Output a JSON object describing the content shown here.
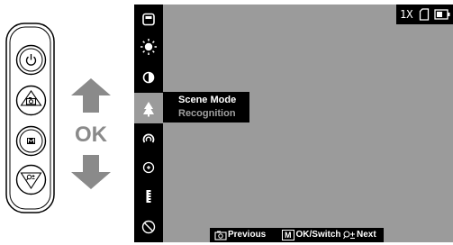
{
  "remote": {
    "buttons": [
      {
        "icon": "power-icon"
      },
      {
        "icon": "camera-icon"
      },
      {
        "icon": "menu-m-icon"
      },
      {
        "icon": "zoom-down-icon"
      }
    ]
  },
  "navigation": {
    "up_icon": "arrow-up-icon",
    "ok_label": "OK",
    "down_icon": "arrow-down-icon"
  },
  "screen": {
    "zoom_level": "1X",
    "menu": {
      "items": [
        {
          "icon": "display-icon"
        },
        {
          "icon": "brightness-icon"
        },
        {
          "icon": "contrast-icon"
        },
        {
          "icon": "scene-mode-icon",
          "selected": true
        },
        {
          "icon": "palette-icon"
        },
        {
          "icon": "reticle-icon"
        },
        {
          "icon": "calibration-icon"
        },
        {
          "icon": "disable-icon"
        }
      ]
    },
    "popup": {
      "title": "Scene Mode",
      "value": "Recognition"
    },
    "hints": {
      "previous": "Previous",
      "switch_key": "M",
      "switch": "OK/Switch",
      "next": "Next"
    }
  },
  "colors": {
    "screen_bg": "#9b9b9b",
    "panel_bg": "#000000",
    "arrow_gray": "#8a8a8a"
  }
}
